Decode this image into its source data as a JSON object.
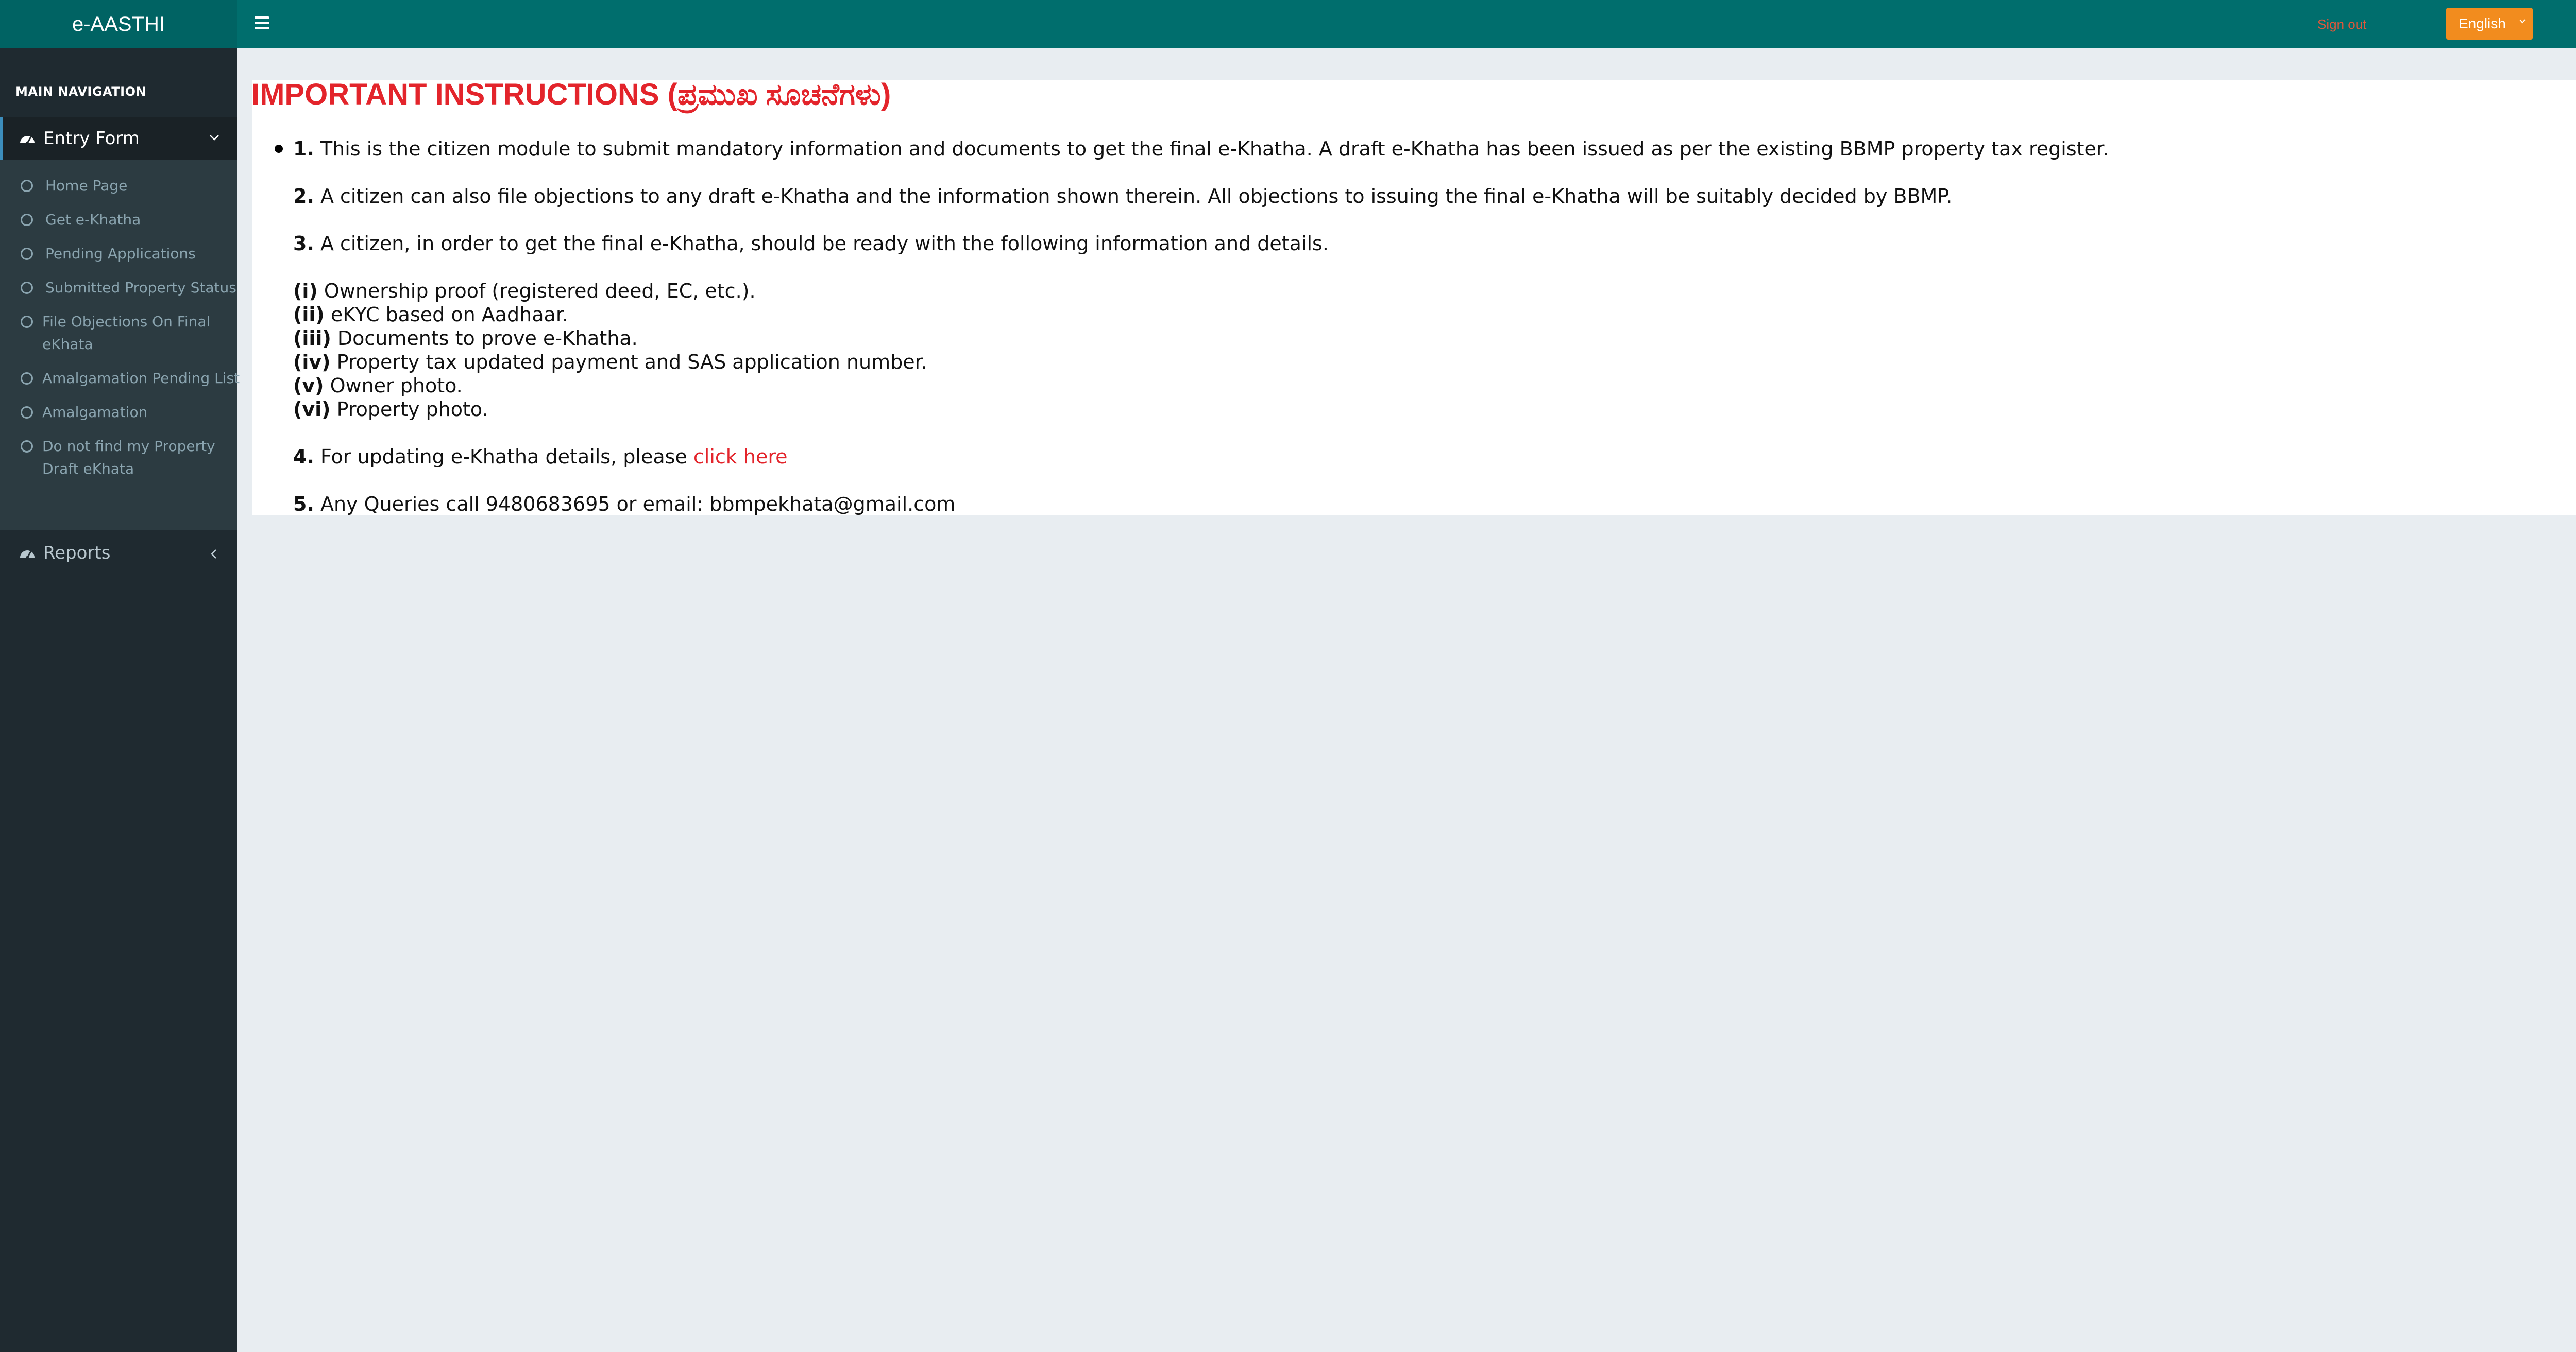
{
  "header": {
    "app_title": "e-AASTHI",
    "language": "English",
    "sign_out": "Sign out"
  },
  "sidebar": {
    "heading": "MAIN NAVIGATION",
    "entry_form": "Entry Form",
    "items": [
      {
        "label": "Home Page"
      },
      {
        "label": "Get e-Khatha"
      },
      {
        "label": "Pending Applications"
      },
      {
        "label": "Submitted Property Status"
      },
      {
        "label": "File Objections On Final eKhata"
      },
      {
        "label": "Amalgamation Pending List"
      },
      {
        "label": "Amalgamation"
      },
      {
        "label": "Do not find my Property Draft eKhata"
      }
    ],
    "reports": "Reports"
  },
  "main": {
    "title": "IMPORTANT INSTRUCTIONS (ಪ್ರಮುಖ ಸೂಚನೆಗಳು)",
    "instructions": [
      {
        "num": "1.",
        "text": " This is the citizen module to submit mandatory information and documents to get the final e-Khatha. A draft e-Khatha has been issued as per the existing BBMP property tax register."
      },
      {
        "num": "2.",
        "text": " A citizen can also file objections to any draft e-Khatha and the information shown therein. All objections to issuing the final e-Khatha will be suitably decided by BBMP."
      },
      {
        "num": "3.",
        "text": " A citizen, in order to get the final e-Khatha, should be ready with the following information and details."
      }
    ],
    "requirements": [
      {
        "num": "(i)",
        "text": " Ownership proof (registered deed, EC, etc.)."
      },
      {
        "num": "(ii)",
        "text": " eKYC based on Aadhaar."
      },
      {
        "num": "(iii)",
        "text": " Documents to prove e-Khatha."
      },
      {
        "num": "(iv)",
        "text": " Property tax updated payment and SAS application number."
      },
      {
        "num": "(v)",
        "text": " Owner photo."
      },
      {
        "num": "(vi)",
        "text": " Property photo."
      }
    ],
    "update": {
      "num": "4.",
      "text": " For updating e-Khatha details, please ",
      "link": "click here"
    },
    "queries": {
      "num": "5.",
      "text": " Any Queries call 9480683695 or email: bbmpekhata@gmail.com"
    }
  }
}
